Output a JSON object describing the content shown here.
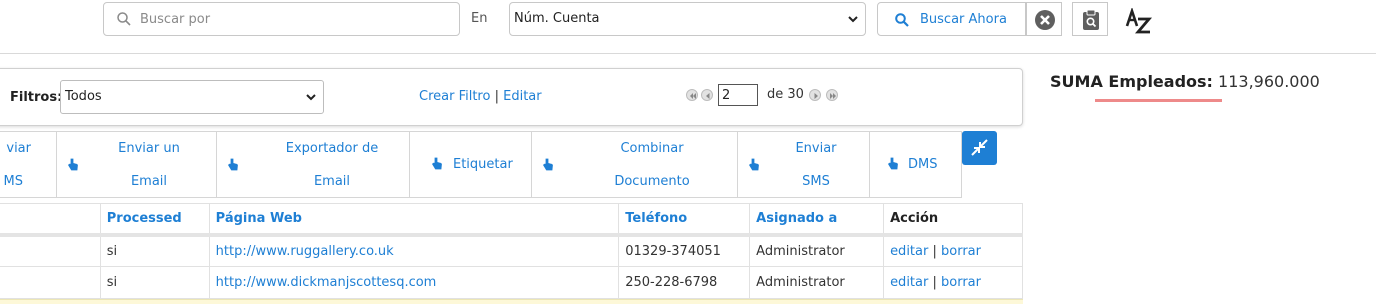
{
  "search": {
    "placeholder": "Buscar por",
    "en_label": "En",
    "field_value": "Núm. Cuenta",
    "button_label": "Buscar Ahora"
  },
  "toolbar": {
    "tools": [
      "clear-icon",
      "clipboard-search-icon",
      "sort-az-icon"
    ],
    "accent": "#1e7fd4"
  },
  "filters": {
    "label": "Filtros:",
    "selected": "Todos",
    "create_label": "Crear Filtro",
    "separator": "|",
    "edit_label": "Editar"
  },
  "pager": {
    "current_page": "2",
    "of_text": "de 30"
  },
  "actions": {
    "a0_line1": "viar",
    "a0_line2": "MS",
    "a1_line1": "Enviar un",
    "a1_line2": "Email",
    "a2_line1": "Exportador de",
    "a2_line2": "Email",
    "a3": "Etiquetar",
    "a4_line1": "Combinar",
    "a4_line2": "Documento",
    "a5_line1": "Enviar",
    "a5_line2": "SMS",
    "a6": "DMS"
  },
  "table": {
    "headers": [
      "",
      "Processed",
      "Página Web",
      "Teléfono",
      "Asignado a",
      "Acción"
    ],
    "rows": [
      {
        "processed": "si",
        "web": "http://www.ruggallery.co.uk",
        "phone": "01329-374051",
        "assigned": "Administrator",
        "edit": "editar",
        "sep": "|",
        "delete": "borrar"
      },
      {
        "processed": "si",
        "web": "http://www.dickmanjscottesq.com",
        "phone": "250-228-6798",
        "assigned": "Administrator",
        "edit": "editar",
        "sep": "|",
        "delete": "borrar"
      }
    ]
  },
  "summary": {
    "label": "SUMA Empleados:",
    "value": "113,960.000"
  }
}
